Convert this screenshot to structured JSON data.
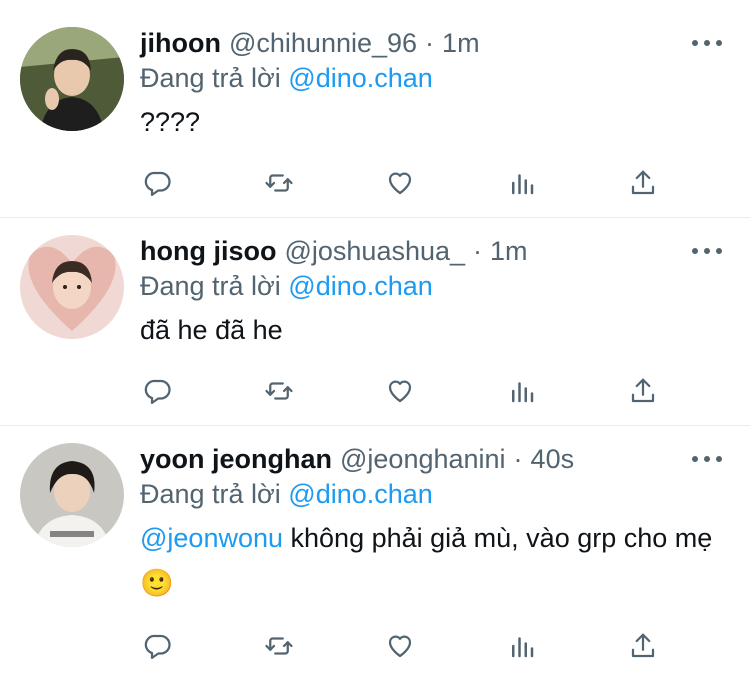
{
  "reply_prefix": "Đang trả lời",
  "tweets": [
    {
      "name": "jihoon",
      "handle": "@chihunnie_96",
      "separator": "·",
      "time": "1m",
      "reply_to": "@dino.chan",
      "text": "????"
    },
    {
      "name": "hong jisoo",
      "handle": "@joshuashua_",
      "separator": "·",
      "time": "1m",
      "reply_to": "@dino.chan",
      "text": "đã he đã he"
    },
    {
      "name": "yoon jeonghan",
      "handle": "@jeonghanini",
      "separator": "·",
      "time": "40s",
      "reply_to": "@dino.chan",
      "mention": "@jeonwonu",
      "text": " không phải giả mù, vào grp cho mẹ",
      "emoji": "🙂"
    }
  ],
  "icons": {
    "reply": "reply-icon",
    "retweet": "retweet-icon",
    "like": "heart-icon",
    "analytics": "analytics-icon",
    "share": "share-icon",
    "more": "more-icon"
  },
  "colors": {
    "link": "#1d9bf0",
    "secondary_text": "#536471",
    "primary_text": "#0f1419",
    "divider": "#e6ecf0"
  }
}
